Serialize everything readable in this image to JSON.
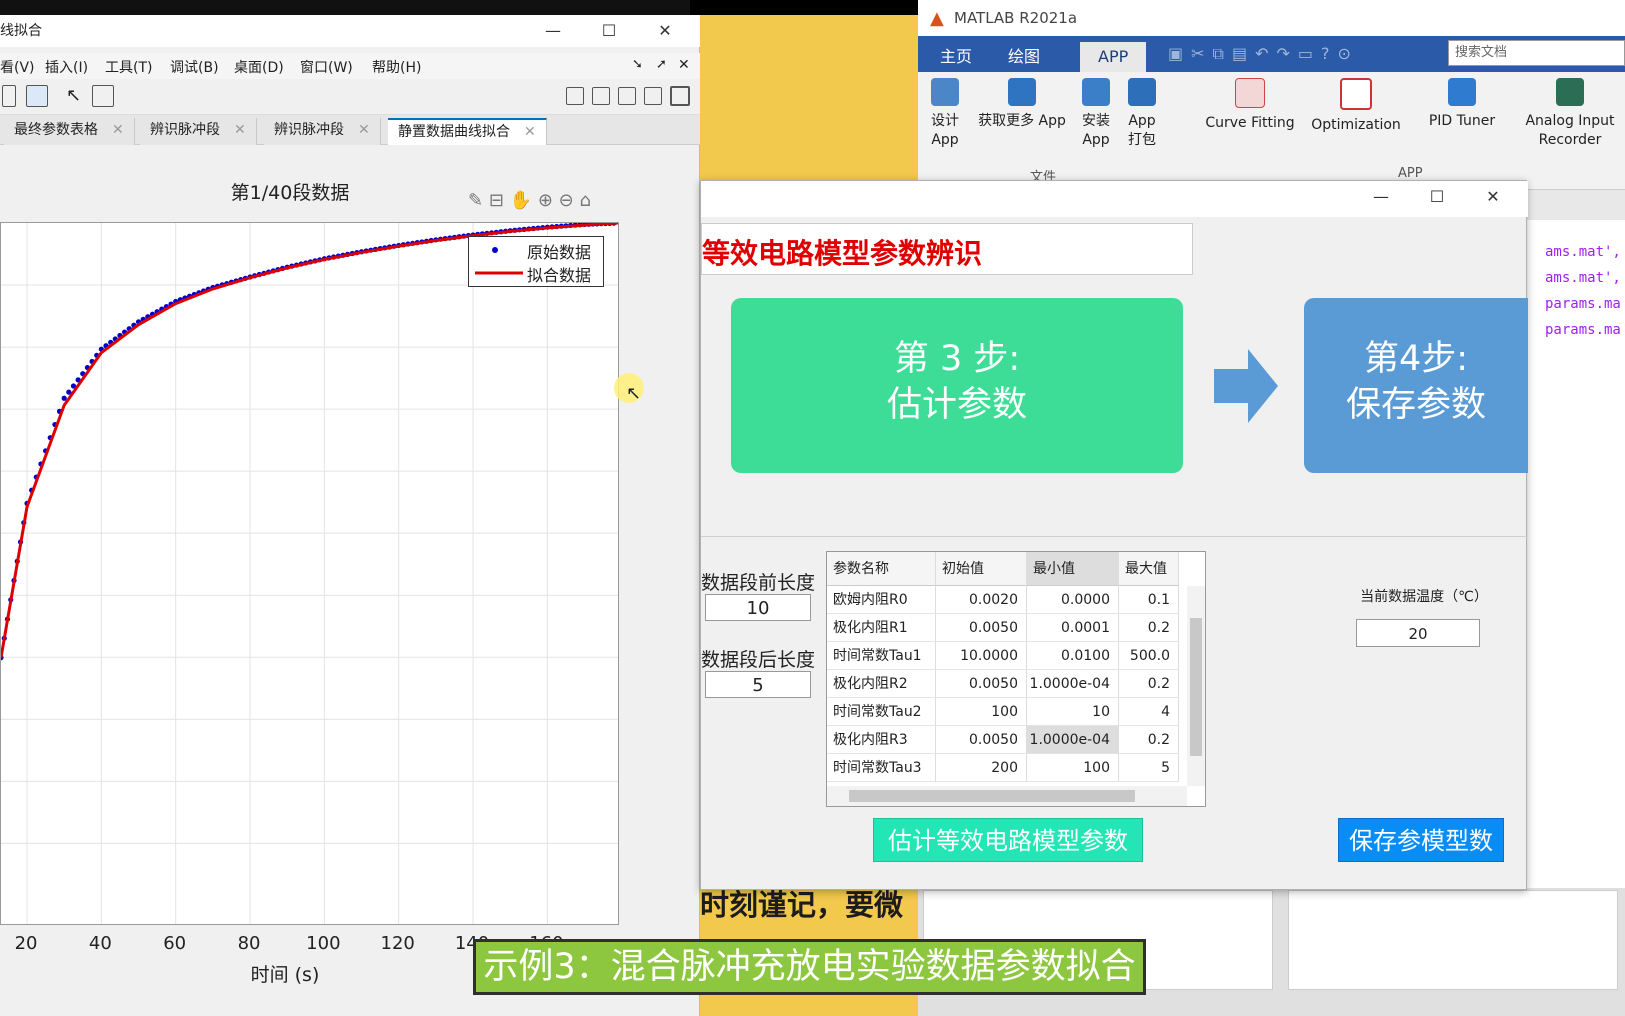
{
  "figure": {
    "title": "线拟合",
    "menu": [
      "看(V)",
      "插入(I)",
      "工具(T)",
      "调试(B)",
      "桌面(D)",
      "窗口(W)",
      "帮助(H)"
    ],
    "tabs": [
      "最终参数表格",
      "辨识脉冲段",
      "辨识脉冲段",
      "静置数据曲线拟合"
    ],
    "active_tab": 3
  },
  "chart_data": {
    "type": "line",
    "title": "第1/40段数据",
    "xlabel": "时间 (s)",
    "ylabel": "",
    "x_ticks": [
      20,
      40,
      60,
      80,
      100,
      120,
      140,
      160
    ],
    "xlim": [
      13,
      179
    ],
    "ylim": [
      0,
      1
    ],
    "grid": true,
    "legend": "top-right",
    "series": [
      {
        "name": "原始数据",
        "style": "markers",
        "color": "#0000cc",
        "x": [
          13,
          20,
          30,
          40,
          50,
          60,
          70,
          80,
          90,
          100,
          110,
          120,
          130,
          140,
          150,
          160,
          170,
          179
        ],
        "y": [
          0.38,
          0.6,
          0.75,
          0.82,
          0.859,
          0.888,
          0.908,
          0.923,
          0.937,
          0.949,
          0.959,
          0.968,
          0.976,
          0.983,
          0.989,
          0.994,
          0.998,
          1.0
        ]
      },
      {
        "name": "拟合数据",
        "style": "line",
        "color": "#dd0000",
        "x": [
          13,
          20,
          30,
          40,
          50,
          60,
          70,
          80,
          90,
          100,
          110,
          120,
          130,
          140,
          150,
          160,
          170,
          179
        ],
        "y": [
          0.38,
          0.595,
          0.74,
          0.815,
          0.855,
          0.885,
          0.906,
          0.922,
          0.936,
          0.948,
          0.958,
          0.967,
          0.975,
          0.982,
          0.988,
          0.993,
          0.997,
          1.0
        ]
      }
    ]
  },
  "matlab": {
    "title": "MATLAB R2021a",
    "tabs": [
      "主页",
      "绘图",
      "APP"
    ],
    "search_placeholder": "搜索文档",
    "ribbon": {
      "design": "设计\nApp",
      "get_more": "获取更多 App",
      "install": "安装\nApp",
      "package": "App\n打包",
      "curve_fitting": "Curve Fitting",
      "optimization": "Optimization",
      "pid_tuner": "PID Tuner",
      "analog": "Analog Input\nRecorder",
      "section_file": "文件",
      "section_app": "APP"
    },
    "code_lines": [
      "ams.mat',",
      "ams.mat',",
      "params.ma",
      "params.ma"
    ]
  },
  "app": {
    "heading": "等效电路模型参数辨识",
    "step3": "第 3 步:\n估计参数",
    "step4": "第4步:\n保存参数",
    "pre_len_label": "数据段前长度",
    "pre_len_value": "10",
    "post_len_label": "数据段后长度",
    "post_len_value": "5",
    "temp_label": "当前数据温度（℃）",
    "temp_value": "20",
    "table": {
      "headers": [
        "参数名称",
        "初始值",
        "最小值",
        "最大值"
      ],
      "rows": [
        [
          "欧姆内阻R0",
          "0.0020",
          "0.0000",
          "0.1"
        ],
        [
          "极化内阻R1",
          "0.0050",
          "0.0001",
          "0.2"
        ],
        [
          "时间常数Tau1",
          "10.0000",
          "0.0100",
          "500.0"
        ],
        [
          "极化内阻R2",
          "0.0050",
          "1.0000e-04",
          "0.2"
        ],
        [
          "时间常数Tau2",
          "100",
          "10",
          "4"
        ],
        [
          "极化内阻R3",
          "0.0050",
          "1.0000e-04",
          "0.2"
        ],
        [
          "时间常数Tau3",
          "200",
          "100",
          "5"
        ]
      ]
    },
    "btn_estimate": "估计等效电路模型参数",
    "btn_save": "保存参模型数"
  },
  "subtitle": "示例3：混合脉冲充放电实验数据参数拟合",
  "background_text": "时刻谨记，要微",
  "colors": {
    "step3": "#3ddc97",
    "step4": "#5b9bd5",
    "heading": "#e00000",
    "subtitle_bg": "#8dc63f"
  }
}
